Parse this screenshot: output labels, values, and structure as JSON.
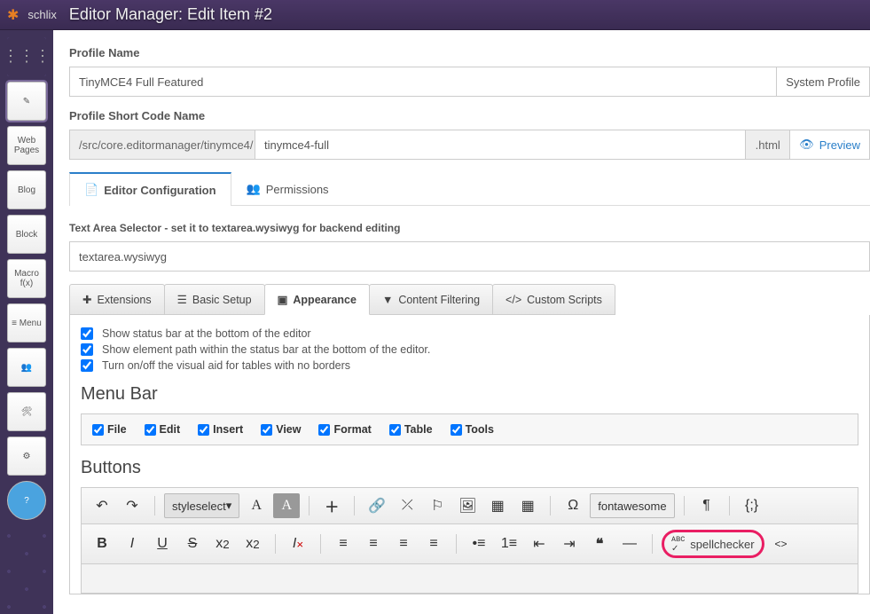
{
  "brand": "schlix",
  "page_title": "Editor Manager: Edit Item #2",
  "sidebar": {
    "items": [
      {
        "name": "apps-grid",
        "label": "⋮⋮⋮"
      },
      {
        "name": "editor",
        "label": "✎"
      },
      {
        "name": "web-pages",
        "label": "Web Pages"
      },
      {
        "name": "blog",
        "label": "Blog"
      },
      {
        "name": "block",
        "label": "Block"
      },
      {
        "name": "macro",
        "label": "Macro f(x)"
      },
      {
        "name": "menu",
        "label": "≡ Menu"
      },
      {
        "name": "users",
        "label": "👥"
      },
      {
        "name": "tools",
        "label": "🛠"
      },
      {
        "name": "settings",
        "label": "⚙"
      },
      {
        "name": "help",
        "label": "?"
      }
    ]
  },
  "form": {
    "profile_name_label": "Profile Name",
    "profile_name_value": "TinyMCE4 Full Featured",
    "system_profile": "System Profile",
    "short_code_label": "Profile Short Code Name",
    "short_code_prefix": "/src/core.editormanager/tinymce4/",
    "short_code_value": "tinymce4-full",
    "short_code_ext": ".html",
    "preview": "Preview"
  },
  "tabs_main": [
    {
      "id": "config",
      "label": "Editor Configuration"
    },
    {
      "id": "perms",
      "label": "Permissions"
    }
  ],
  "textarea_selector_label": "Text Area Selector - set it to textarea.wysiwyg for backend editing",
  "textarea_selector_value": "textarea.wysiwyg",
  "tabs_inner": [
    {
      "id": "ext",
      "label": "Extensions",
      "icon": "puzzle"
    },
    {
      "id": "basic",
      "label": "Basic Setup",
      "icon": "list"
    },
    {
      "id": "appearance",
      "label": "Appearance",
      "icon": "window"
    },
    {
      "id": "filter",
      "label": "Content Filtering",
      "icon": "funnel"
    },
    {
      "id": "scripts",
      "label": "Custom Scripts",
      "icon": "code"
    }
  ],
  "appearance_checks": [
    "Show status bar at the bottom of the editor",
    "Show element path within the status bar at the bottom of the editor.",
    "Turn on/off the visual aid for tables with no borders"
  ],
  "menu_bar_title": "Menu Bar",
  "menu_bar_items": [
    "File",
    "Edit",
    "Insert",
    "View",
    "Format",
    "Table",
    "Tools"
  ],
  "buttons_title": "Buttons",
  "toolbar": {
    "styleselect": "styleselect",
    "fontawesome": "fontawesome",
    "spellchecker": "spellchecker"
  }
}
